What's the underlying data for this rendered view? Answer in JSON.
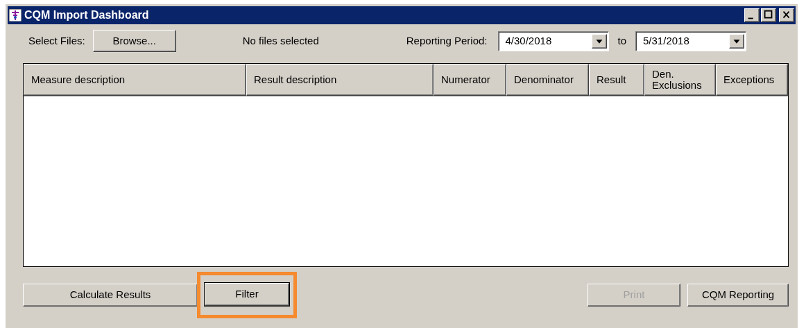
{
  "window": {
    "title": "CQM Import Dashboard"
  },
  "file_select": {
    "label": "Select Files:",
    "button": "Browse...",
    "status": "No files selected"
  },
  "reporting_period": {
    "label": "Reporting Period:",
    "from": "4/30/2018",
    "separator": "to",
    "to": "5/31/2018"
  },
  "table": {
    "columns": [
      "Measure description",
      "Result description",
      "Numerator",
      "Denominator",
      "Result",
      "Den. Exclusions",
      "Exceptions"
    ]
  },
  "buttons": [
    {
      "label": "Calculate Results",
      "disabled": false,
      "highlighted": false
    },
    {
      "label": "Filter",
      "disabled": false,
      "highlighted": true
    },
    {
      "label": "Print",
      "disabled": true,
      "highlighted": false
    },
    {
      "label": "CQM Reporting",
      "disabled": false,
      "highlighted": false
    }
  ]
}
